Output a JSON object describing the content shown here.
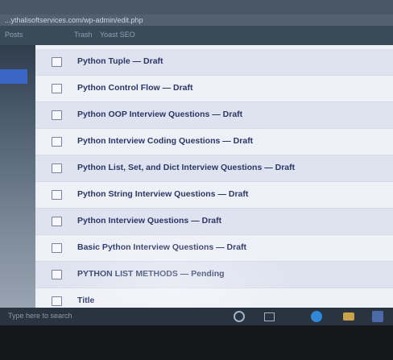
{
  "browser": {
    "url": "...ythalisoftservices.com/wp-admin/edit.php"
  },
  "admin_bar": {
    "items": [
      "Posts",
      "Trash",
      "Yoast SEO"
    ]
  },
  "posts": [
    {
      "title": "Python Tuple — Draft"
    },
    {
      "title": "Python Control Flow — Draft"
    },
    {
      "title": "Python OOP Interview Questions — Draft"
    },
    {
      "title": "Python Interview Coding Questions — Draft"
    },
    {
      "title": "Python List, Set, and Dict Interview Questions — Draft"
    },
    {
      "title": "Python String Interview Questions — Draft"
    },
    {
      "title": "Python Interview Questions — Draft"
    },
    {
      "title": "Basic Python Interview Questions — Draft"
    },
    {
      "title": "PYTHON LIST METHODS — Pending"
    },
    {
      "title": "Title"
    }
  ],
  "taskbar": {
    "search_text": "Type here to search"
  },
  "colors": {
    "accent": "#3a66c8",
    "row_title": "#2a3766"
  }
}
